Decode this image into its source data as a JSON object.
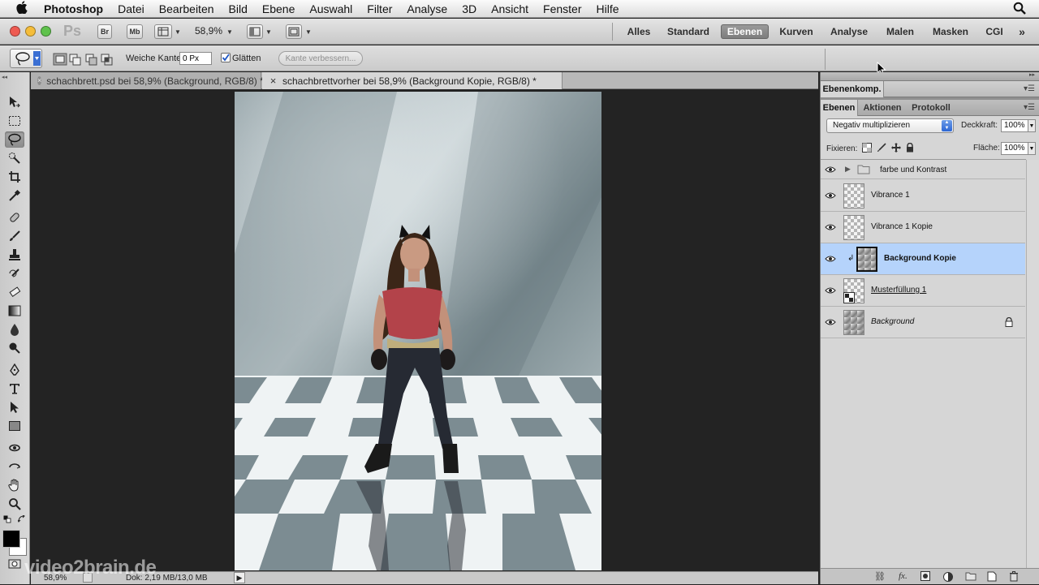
{
  "menubar": {
    "app_name": "Photoshop",
    "items": [
      "Datei",
      "Bearbeiten",
      "Bild",
      "Ebene",
      "Auswahl",
      "Filter",
      "Analyse",
      "3D",
      "Ansicht",
      "Fenster",
      "Hilfe"
    ]
  },
  "appbar": {
    "logo": "Ps",
    "bridge": "Br",
    "minibridge": "Mb",
    "zoom": "58,9%",
    "workspaces": [
      "Alles",
      "Standard",
      "Ebenen",
      "Kurven",
      "Analyse",
      "Malen",
      "Masken",
      "CGI"
    ],
    "active_workspace": "Ebenen",
    "more": "»"
  },
  "options": {
    "feather_label": "Weiche Kante:",
    "feather_value": "0 Px",
    "antialias_label": "Glätten",
    "antialias_checked": true,
    "refine_edge": "Kante verbessern..."
  },
  "tabs": [
    {
      "title": "schachbrett.psd bei 58,9% (Background, RGB/8) *",
      "active": false
    },
    {
      "title": "schachbrettvorher bei 58,9% (Background Kopie, RGB/8) *",
      "active": true
    }
  ],
  "status": {
    "zoom": "58,9%",
    "doc": "Dok: 2,19 MB/13,0 MB"
  },
  "watermark": "video2brain.de",
  "panels": {
    "top_title": "Ebenenkomp.",
    "tabs": [
      "Ebenen",
      "Aktionen",
      "Protokoll"
    ],
    "blend_mode": "Negativ multiplizieren",
    "opacity_label": "Deckkraft:",
    "opacity": "100%",
    "lock_label": "Fixieren:",
    "fill_label": "Fläche:",
    "fill": "100%"
  },
  "layers": [
    {
      "name": "farbe und Kontrast",
      "type": "group",
      "visible": true
    },
    {
      "name": "Vibrance 1",
      "type": "adjustment",
      "visible": true
    },
    {
      "name": "Vibrance 1 Kopie",
      "type": "adjustment",
      "visible": true
    },
    {
      "name": "Background Kopie",
      "type": "image",
      "visible": true,
      "selected": true,
      "clipped": true
    },
    {
      "name": "Musterfüllung 1",
      "type": "fill",
      "visible": true
    },
    {
      "name": "Background",
      "type": "background",
      "visible": true,
      "locked": true
    }
  ],
  "colors": {
    "accent_selected": "#b5d3fb",
    "canvas_bg": "#232323",
    "traffic_red": "#ee5b52",
    "traffic_yellow": "#f5bd3a",
    "traffic_green": "#5fc24c"
  }
}
